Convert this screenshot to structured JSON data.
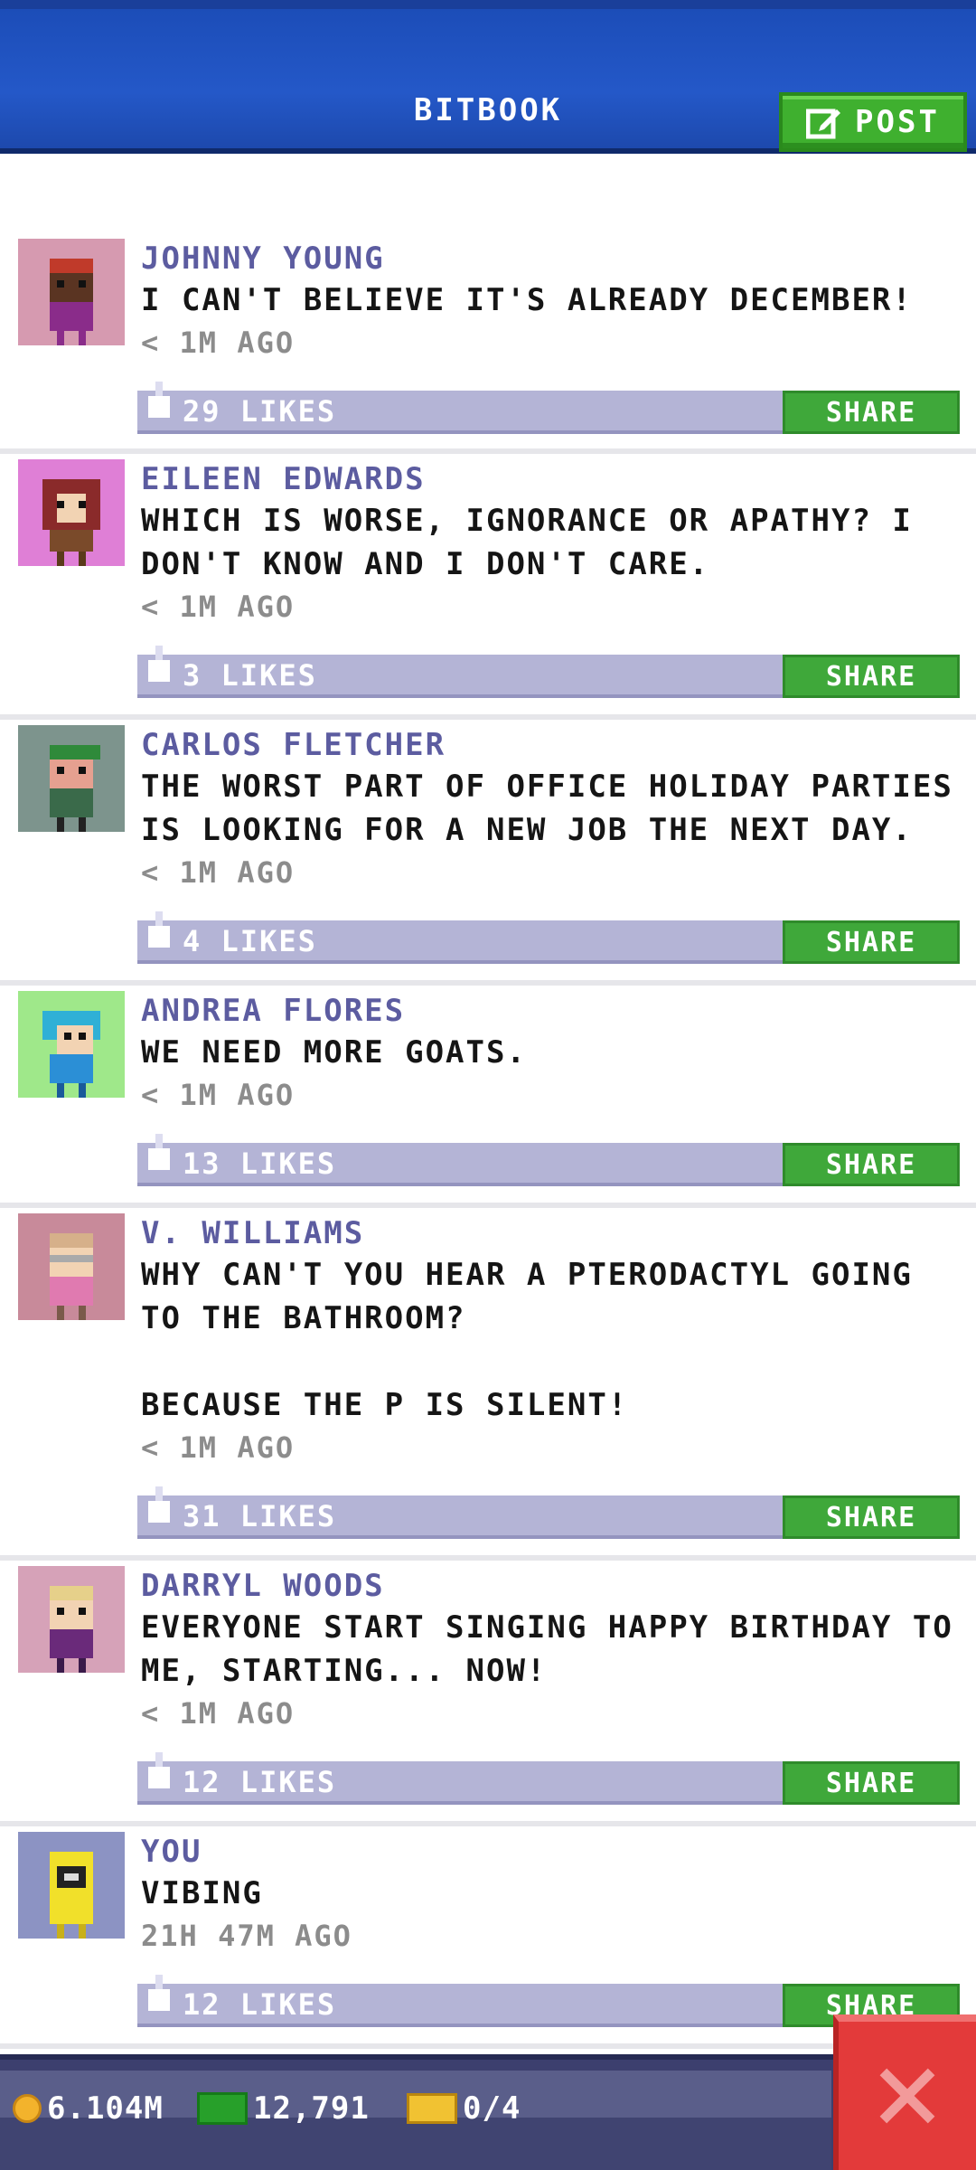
{
  "header": {
    "title": "BITBOOK",
    "post_label": "POST"
  },
  "posts": [
    {
      "author": "JOHNNY YOUNG",
      "message": "I CAN'T BELIEVE IT'S ALREADY DECEMBER!",
      "time": "< 1M AGO",
      "likes": "29 LIKES",
      "share": "SHARE",
      "avatar_bg": "#d69ab0",
      "avatar_color": "#8a2c8a"
    },
    {
      "author": "EILEEN EDWARDS",
      "message": "WHICH IS WORSE, IGNORANCE OR APATHY? I DON'T KNOW AND I DON'T CARE.",
      "time": "< 1M AGO",
      "likes": "3 LIKES",
      "share": "SHARE",
      "avatar_bg": "#df7fd6",
      "avatar_color": "#7a4a2a"
    },
    {
      "author": "CARLOS FLETCHER",
      "message": "THE WORST PART OF OFFICE HOLIDAY PARTIES IS LOOKING FOR A NEW JOB THE NEXT DAY.",
      "time": "< 1M AGO",
      "likes": "4 LIKES",
      "share": "SHARE",
      "avatar_bg": "#7d948d",
      "avatar_color": "#3a6a4a"
    },
    {
      "author": "ANDREA FLORES",
      "message": "WE NEED MORE GOATS.",
      "time": "< 1M AGO",
      "likes": "13 LIKES",
      "share": "SHARE",
      "avatar_bg": "#9fe88a",
      "avatar_color": "#2b8fd6"
    },
    {
      "author": "V. WILLIAMS",
      "message": "WHY CAN'T YOU HEAR A PTERODACTYL GOING TO THE BATHROOM?\n\nBECAUSE THE P IS SILENT!",
      "time": "< 1M AGO",
      "likes": "31 LIKES",
      "share": "SHARE",
      "avatar_bg": "#c88a9a",
      "avatar_color": "#e07ab0"
    },
    {
      "author": "DARRYL WOODS",
      "message": "EVERYONE START SINGING HAPPY BIRTHDAY TO ME, STARTING... NOW!",
      "time": "< 1M AGO",
      "likes": "12 LIKES",
      "share": "SHARE",
      "avatar_bg": "#d6a2b8",
      "avatar_color": "#6a2a7a"
    },
    {
      "author": "YOU",
      "message": "VIBING",
      "time": "21H 47M AGO",
      "likes": "12 LIKES",
      "share": "SHARE",
      "avatar_bg": "#8c93c3",
      "avatar_color": "#f1e02a"
    }
  ],
  "status": {
    "coins": "6.104M",
    "cash": "12,791",
    "tickets": "0/4"
  },
  "icons": {
    "post": "edit-icon",
    "like": "thumbs-up-icon",
    "coin": "coin-icon",
    "cash": "cash-icon",
    "ticket": "ticket-icon",
    "close": "close-icon"
  },
  "colors": {
    "header": "#2458c8",
    "accent_green": "#3fa83a",
    "author_purple": "#5c5ca0",
    "likes_bar": "#b4b4d6",
    "close_red": "#e33a3a"
  }
}
